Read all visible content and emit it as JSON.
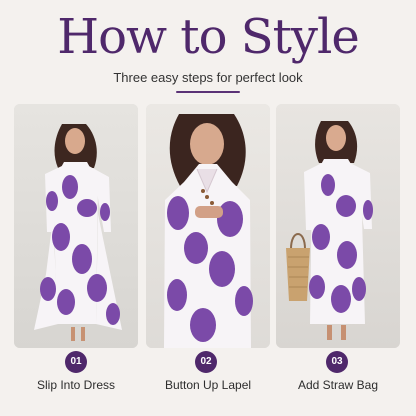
{
  "header": {
    "title": "How to Style",
    "subtitle": "Three easy steps for perfect look"
  },
  "steps": [
    {
      "number": "01",
      "label": "Slip Into Dress",
      "image_icon": "model-full-length-photo-icon"
    },
    {
      "number": "02",
      "label": "Button Up Lapel",
      "image_icon": "model-closeup-photo-icon"
    },
    {
      "number": "03",
      "label": "Add Straw Bag",
      "image_icon": "model-with-bag-photo-icon"
    }
  ],
  "colors": {
    "accent": "#4f286b",
    "background": "#f4f1ee",
    "dress_print": "#7b4aa8",
    "dress_base": "#f7f4f7"
  }
}
